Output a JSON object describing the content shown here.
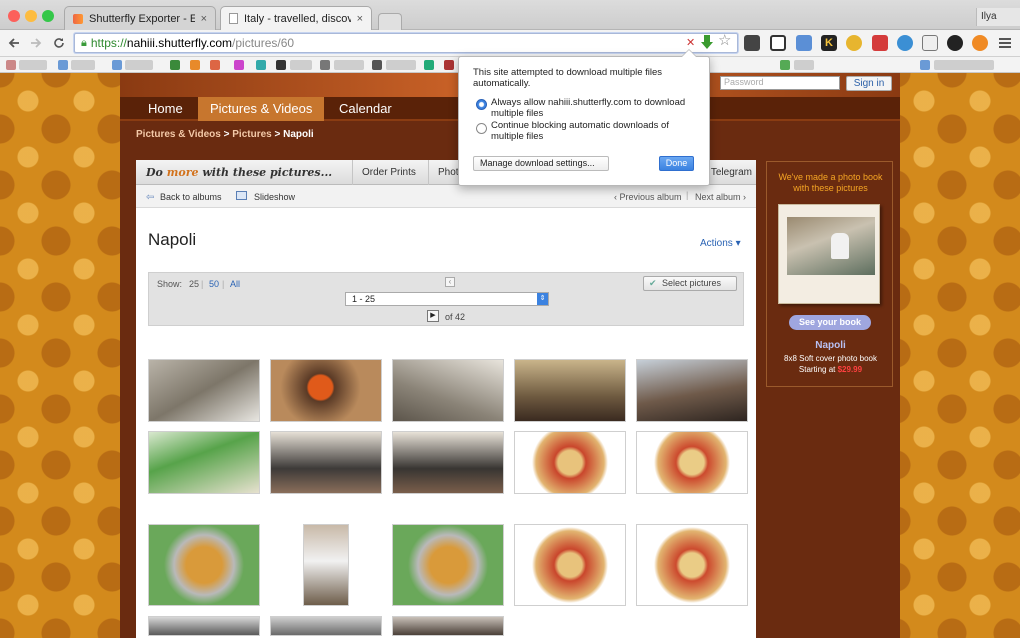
{
  "browser": {
    "tabs": [
      {
        "title": "Shutterfly Exporter - Edit it",
        "close": "×"
      },
      {
        "title": "Italy - travelled, discovered",
        "close": "×"
      }
    ],
    "user": "Ilya",
    "url": {
      "scheme": "https://",
      "host": "nahiii.shutterfly.com",
      "path": "/pictures/60"
    },
    "icons": {
      "back": "back-icon",
      "forward": "forward-icon",
      "reload": "reload-icon",
      "menu": "menu-icon"
    }
  },
  "site": {
    "password_placeholder": "Password",
    "signin": "Sign in",
    "nav": [
      "Home",
      "Pictures & Videos",
      "Calendar"
    ],
    "breadcrumb": {
      "part1": "Pictures & Videos",
      "sep": ">",
      "part2": "Pictures",
      "part3": "Napoli"
    }
  },
  "album": {
    "do_more_a": "Do ",
    "do_more_b": "more",
    "do_more_c": " with these pictures...",
    "buttons": [
      "Order Prints",
      "Photo"
    ],
    "button_right": "Telegram",
    "back": "Back to albums",
    "slideshow": "Slideshow",
    "prev": "‹ Previous album",
    "next": "Next album ›",
    "title": "Napoli",
    "actions": "Actions ▾",
    "show_label": "Show:",
    "show_25": "25",
    "show_50": "50",
    "show_all": "All",
    "range": "1 - 25",
    "of": "of 42",
    "select_pictures": "Select pictures"
  },
  "popup": {
    "message": "This site attempted to download multiple files automatically.",
    "option1": "Always allow nahiii.shutterfly.com to download multiple files",
    "option2": "Continue blocking automatic downloads of multiple files",
    "manage": "Manage download settings...",
    "done": "Done",
    "selected": "option1"
  },
  "photobook": {
    "heading": "We've made a photo book with these pictures",
    "button": "See your book",
    "name": "Napoli",
    "desc": "8x8 Soft cover photo book",
    "starting": "Starting at",
    "price": "$29.99"
  },
  "colors": {
    "brand_orange": "#d2721c",
    "link": "#2a63b4",
    "page_bg": "#d38a1c"
  }
}
